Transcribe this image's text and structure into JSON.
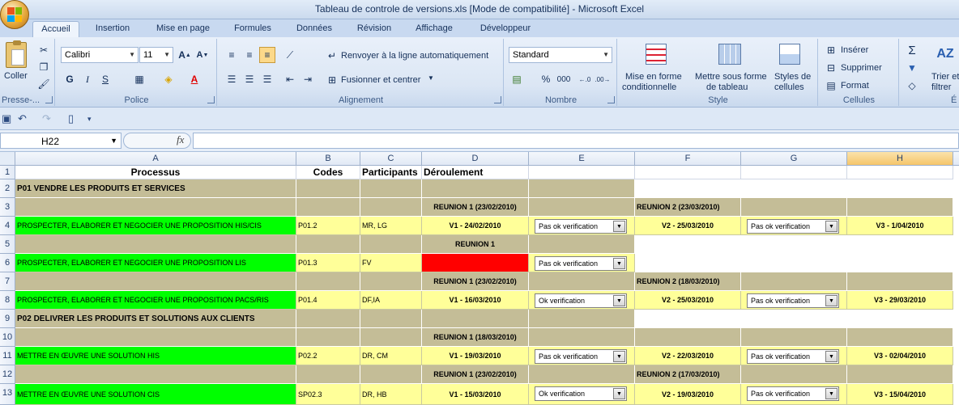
{
  "window": {
    "title": "Tableau de controle de versions.xls  [Mode de compatibilité] - Microsoft Excel"
  },
  "tabs": [
    "Accueil",
    "Insertion",
    "Mise en page",
    "Formules",
    "Données",
    "Révision",
    "Affichage",
    "Développeur"
  ],
  "ribbon": {
    "clipboard": {
      "paste_label": "Coller",
      "group_label": "Presse-..."
    },
    "font": {
      "font_name": "Calibri",
      "font_size": "11",
      "group_label": "Police",
      "bold": "G",
      "italic": "I",
      "underline": "S"
    },
    "alignment": {
      "wrap_label": "Renvoyer à la ligne automatiquement",
      "merge_label": "Fusionner et centrer",
      "group_label": "Alignement"
    },
    "number": {
      "format": "Standard",
      "percent": "%",
      "thousands": "000",
      "group_label": "Nombre"
    },
    "style": {
      "conditional_line1": "Mise en forme",
      "conditional_line2": "conditionnelle",
      "table_line1": "Mettre sous forme",
      "table_line2": "de tableau",
      "cell_styles_line1": "Styles de",
      "cell_styles_line2": "cellules",
      "group_label": "Style"
    },
    "cells": {
      "insert": "Insérer",
      "delete": "Supprimer",
      "format": "Format",
      "group_label": "Cellules"
    },
    "editing": {
      "sort_line1": "Trier et",
      "sort_line2": "filtrer",
      "group_label": "É"
    }
  },
  "formula_bar": {
    "name_box": "H22",
    "fx": "fx",
    "content": ""
  },
  "columns": [
    "A",
    "B",
    "C",
    "D",
    "E",
    "F",
    "G",
    "H"
  ],
  "rows": [
    "1",
    "2",
    "3",
    "4",
    "5",
    "6",
    "7",
    "8",
    "9",
    "10",
    "11",
    "12",
    "13"
  ],
  "header_row": {
    "processus": "Processus",
    "codes": "Codes",
    "participants": "Participants",
    "deroulement": "Déroulement"
  },
  "sections": {
    "p01": "P01 VENDRE LES PRODUITS ET SERVICES",
    "p02": "P02 DELIVRER LES PRODUITS ET SOLUTIONS AUX CLIENTS"
  },
  "meetings": {
    "r3d": "REUNION 1 (23/02/2010)",
    "r3f": "REUNION 2 (23/03/2010)",
    "r5d": "REUNION 1",
    "r7d": "REUNION 1 (23/02/2010)",
    "r7f": "REUNION 2 (18/03/2010)",
    "r10d": "REUNION 1 (18/03/2010)",
    "r12d": "REUNION 1 (23/02/2010)",
    "r12f": "REUNION 2 (17/03/2010)"
  },
  "process_rows": [
    {
      "name": "PROSPECTER, ELABORER ET NEGOCIER UNE PROPOSITION HIS/CIS",
      "code": "P01.2",
      "participants": "MR, LG",
      "v1": "V1 - 24/02/2010",
      "check1": "Pas ok verification",
      "v2": "V2 - 25/03/2010",
      "check2": "Pas ok verification",
      "v3": "V3 - 1/04/2010"
    },
    {
      "name": "PROSPECTER, ELABORER ET NEGOCIER UNE PROPOSITION LIS",
      "code": "P01.3",
      "participants": "FV",
      "v1": "",
      "check1": "Pas ok verification",
      "v2": "",
      "check2": "",
      "v3": ""
    },
    {
      "name": "PROSPECTER, ELABORER ET NEGOCIER UNE PROPOSITION PACS/RIS",
      "code": "P01.4",
      "participants": "DF,IA",
      "v1": "V1 - 16/03/2010",
      "check1": "Ok verification",
      "v2": "V2 - 25/03/2010",
      "check2": "Pas ok verification",
      "v3": "V3 - 29/03/2010"
    },
    {
      "name": "METTRE EN ŒUVRE UNE SOLUTION HIS",
      "code": "P02.2",
      "participants": "DR, CM",
      "v1": "V1 - 19/03/2010",
      "check1": "Pas ok verification",
      "v2": "V2 - 22/03/2010",
      "check2": "Pas ok verification",
      "v3": "V3 - 02/04/2010"
    },
    {
      "name": "METTRE EN ŒUVRE UNE SOLUTION CIS",
      "code": "SP02.3",
      "participants": "DR, HB",
      "v1": "V1 - 15/03/2010",
      "check1": "Ok verification",
      "v2": "V2 - 19/03/2010",
      "check2": "Pas ok verification",
      "v3": "V3 - 15/04/2010"
    }
  ],
  "colors": {
    "tan": "#c4bd97",
    "yellow": "#ffff99",
    "green": "#00ff00",
    "red": "#ff0000",
    "ribbon": "#dbe6f4"
  }
}
